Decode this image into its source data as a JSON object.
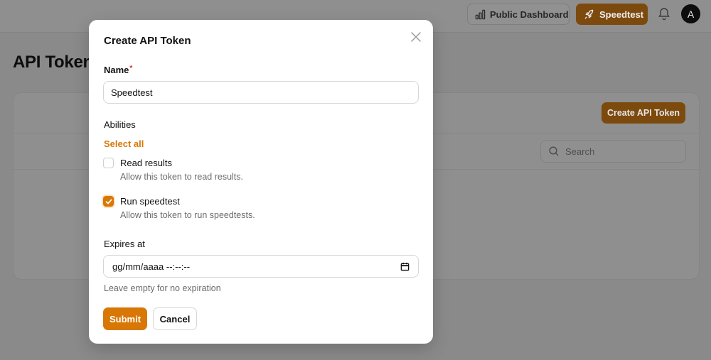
{
  "header": {
    "public_dashboard_label": "Public Dashboard",
    "speedtest_label": "Speedtest",
    "avatar_initial": "A"
  },
  "page": {
    "title": "API Tokens",
    "create_button_label": "Create API Token",
    "search_placeholder": "Search"
  },
  "modal": {
    "title": "Create API Token",
    "name_label": "Name",
    "name_required_mark": "*",
    "name_value": "Speedtest",
    "abilities_label": "Abilities",
    "select_all_label": "Select all",
    "abilities": [
      {
        "label": "Read results",
        "description": "Allow this token to read results.",
        "checked": false
      },
      {
        "label": "Run speedtest",
        "description": "Allow this token to run speedtests.",
        "checked": true
      }
    ],
    "expires_label": "Expires at",
    "expires_placeholder": "gg/mm/aaaa --:--:--",
    "expires_hint": "Leave empty for no expiration",
    "submit_label": "Submit",
    "cancel_label": "Cancel"
  },
  "colors": {
    "accent": "#d97706",
    "overlay": "#8a8a8a",
    "required": "#dc2626"
  },
  "icons": {
    "public_dashboard": "bar-chart-icon",
    "speedtest": "rocket-icon",
    "notifications": "bell-icon",
    "close": "close-icon",
    "search": "search-icon",
    "calendar": "calendar-icon",
    "check": "check-icon"
  }
}
